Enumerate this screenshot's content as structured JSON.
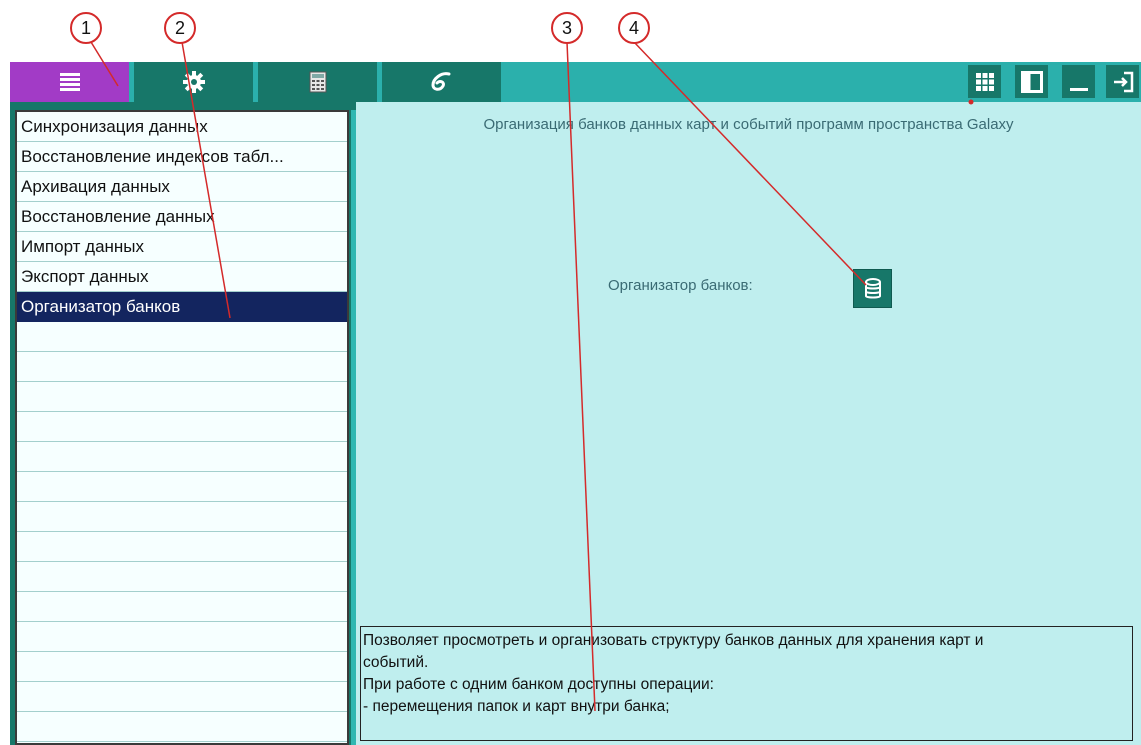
{
  "callouts": [
    "1",
    "2",
    "3",
    "4"
  ],
  "toolbar": {
    "tabs": [
      {
        "icon": "list-icon",
        "active": true
      },
      {
        "icon": "gear-icon",
        "active": false
      },
      {
        "icon": "calculator-icon",
        "active": false
      },
      {
        "icon": "galaxy-logo-icon",
        "active": false
      }
    ],
    "window_buttons": [
      "grid-view-icon",
      "panel-toggle-icon",
      "minimize-icon",
      "exit-icon"
    ]
  },
  "sidebar": {
    "items": [
      {
        "label": "Синхронизация данных"
      },
      {
        "label": "Восстановление индексов табл..."
      },
      {
        "label": "Архивация данных"
      },
      {
        "label": "Восстановление данных"
      },
      {
        "label": "Импорт данных"
      },
      {
        "label": "Экспорт данных"
      },
      {
        "label": "Организатор банков",
        "selected": true
      }
    ]
  },
  "main": {
    "title": "Организация банков данных карт и событий программ пространства Galaxy",
    "organizer_label": "Организатор банков:",
    "organizer_button_icon": "database-icon",
    "description": {
      "line1": "Позволяет просмотреть и организовать структуру банков данных для хранения карт и",
      "line2": "событий.",
      "line3": "При работе с одним банком доступны операции:",
      "line4": "- перемещения папок и карт внутри банка;"
    }
  },
  "colors": {
    "toolbar_bg": "#2bb0ac",
    "tab_bg": "#177769",
    "active_tab": "#a23bc6",
    "content_bg": "#bfeeee",
    "selected_row": "#13255f",
    "callout_red": "#d42a2a"
  }
}
